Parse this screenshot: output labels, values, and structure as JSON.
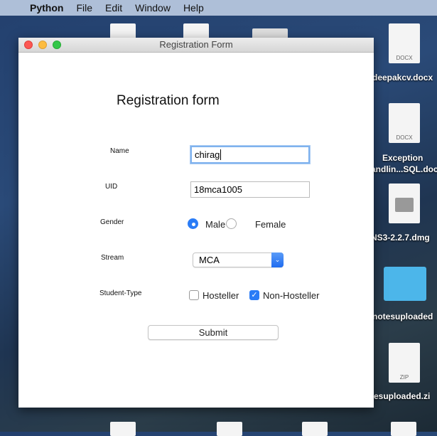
{
  "menubar": {
    "app": "Python",
    "items": [
      "File",
      "Edit",
      "Window",
      "Help"
    ]
  },
  "desktop": {
    "icons": [
      {
        "label": "deepakcv.docx",
        "tag": "DOCX"
      },
      {
        "label": "Exception",
        "label2": "andlin...SQL.doc",
        "tag": "DOCX"
      },
      {
        "label": "NS3-2.2.7.dmg",
        "tag": ""
      },
      {
        "label": "notesuploaded",
        "tag": ""
      },
      {
        "label": "tesuploaded.zi",
        "tag": "ZIP"
      }
    ]
  },
  "window": {
    "title": "Registration Form"
  },
  "form": {
    "heading": "Registration form",
    "name_label": "Name",
    "name_value": "chirag",
    "uid_label": "UID",
    "uid_value": "18mca1005",
    "gender_label": "Gender",
    "gender_options": [
      "Male",
      "Female"
    ],
    "gender_selected": "Male",
    "stream_label": "Stream",
    "stream_value": "MCA",
    "type_label": "Student-Type",
    "hosteller": "Hosteller",
    "non_hosteller": "Non-Hosteller",
    "hosteller_checked": false,
    "non_hosteller_checked": true,
    "submit": "Submit"
  }
}
